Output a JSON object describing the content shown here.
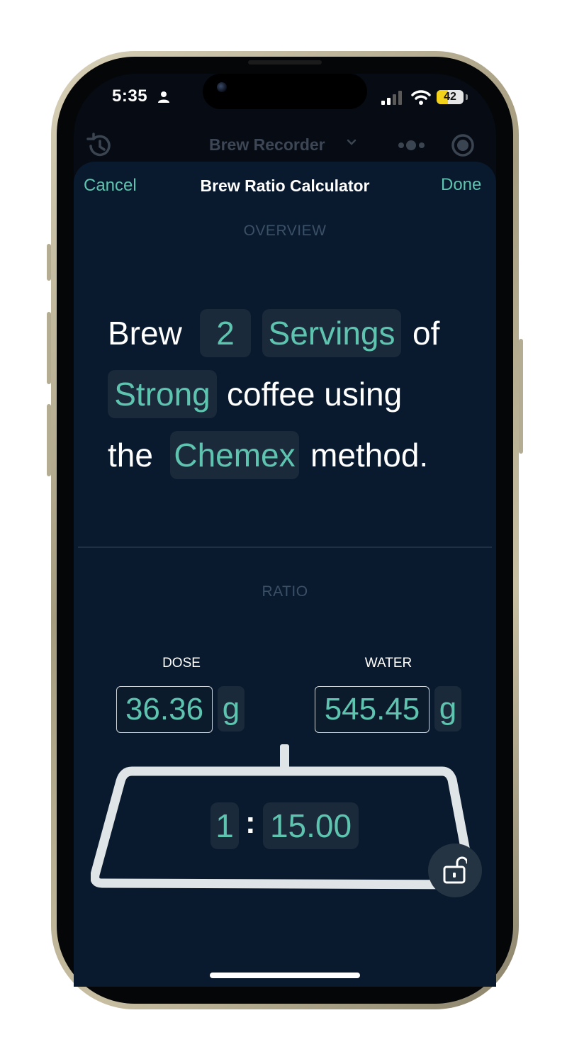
{
  "status_bar": {
    "time": "5:35",
    "battery": "42",
    "battery_level": 0.42
  },
  "background_app": {
    "title": "Brew Recorder"
  },
  "nav": {
    "cancel_label": "Cancel",
    "title": "Brew Ratio Calculator",
    "done_label": "Done"
  },
  "overview": {
    "section_label": "OVERVIEW",
    "word_brew": "Brew",
    "servings_count": "2",
    "servings_unit": "Servings",
    "word_of": "of",
    "strength": "Strong",
    "word_coffee_using": "coffee using",
    "word_the": "the",
    "method": "Chemex",
    "word_method": "method."
  },
  "ratio": {
    "section_label": "RATIO",
    "dose_label": "DOSE",
    "dose_value": "36.36",
    "dose_unit": "g",
    "water_label": "WATER",
    "water_value": "545.45",
    "water_unit": "g",
    "ratio_left": "1",
    "ratio_separator": ":",
    "ratio_right": "15.00"
  },
  "icons": {
    "person": "person-icon",
    "signal": "cellular-signal-icon",
    "wifi": "wifi-icon",
    "history": "history-icon",
    "dots": "dots-icon",
    "record": "record-icon",
    "lock": "unlock-icon"
  },
  "colors": {
    "accent": "#5ec4b0",
    "sheet_background": "#0a1a2e",
    "chip_background": "#1a2a3a",
    "battery": "#f2d21b"
  }
}
